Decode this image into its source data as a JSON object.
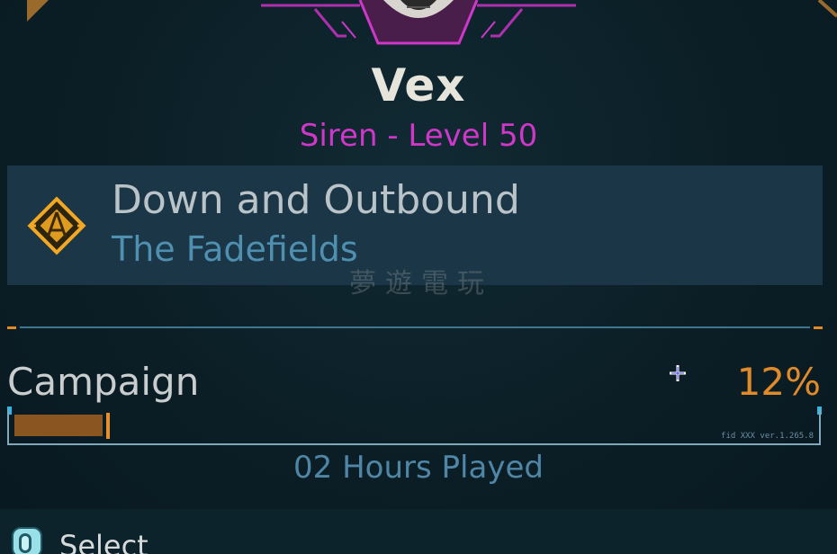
{
  "character": {
    "name": "Vex",
    "class_level": "Siren - Level 50"
  },
  "mission": {
    "title": "Down and Outbound",
    "location": "The Fadefields"
  },
  "watermark": "夢遊電玩",
  "campaign": {
    "label": "Campaign",
    "percent_text": "12%",
    "progress_fraction": 0.12,
    "version": "fid  XXX  ver.1.265.8",
    "hours_played": "02 Hours Played"
  },
  "footer": {
    "select_label": "Select"
  },
  "colors": {
    "accent_magenta": "#cf37c9",
    "accent_orange": "#e08a2a",
    "panel": "#1b3646"
  },
  "icons": {
    "mission": "mission-diamond-icon",
    "cursor": "crosshair-cursor-icon",
    "select": "controller-button-icon"
  }
}
